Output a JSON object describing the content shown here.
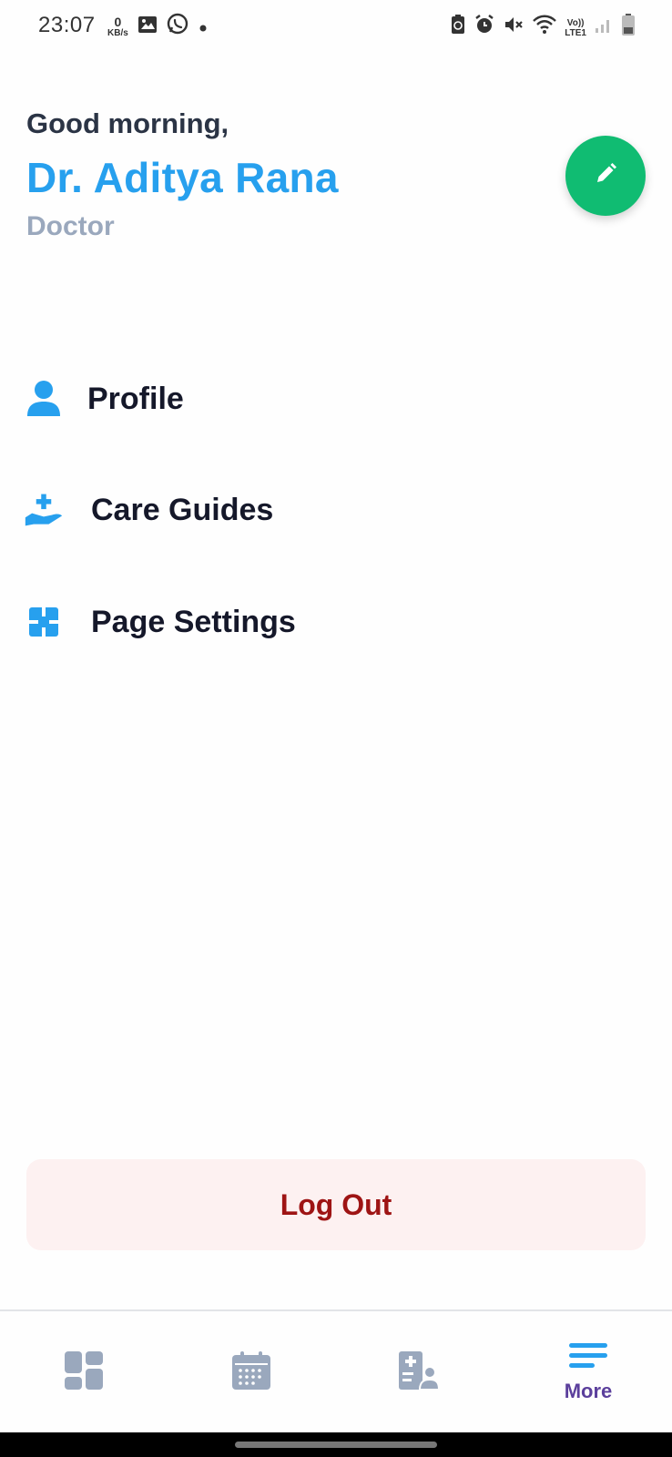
{
  "status_bar": {
    "time": "23:07",
    "net_speed_value": "0",
    "net_speed_unit": "KB/s",
    "network_label_top": "Vo))",
    "network_label_bottom": "LTE1",
    "left_icons": [
      "gallery-icon",
      "whatsapp-icon",
      "dot-icon"
    ],
    "right_icons": [
      "battery-saver-icon",
      "alarm-icon",
      "mute-icon",
      "wifi-icon",
      "signal-icon",
      "battery-icon"
    ]
  },
  "header": {
    "greeting": "Good morning,",
    "name": "Dr. Aditya Rana",
    "role": "Doctor",
    "edit_icon": "pencil-icon"
  },
  "menu": {
    "items": [
      {
        "label": "Profile",
        "icon": "user-icon"
      },
      {
        "label": "Care Guides",
        "icon": "hand-holding-medical-icon"
      },
      {
        "label": "Page Settings",
        "icon": "puzzle-icon"
      }
    ]
  },
  "logout": {
    "label": "Log Out"
  },
  "bottom_nav": {
    "items": [
      {
        "icon": "dashboard-icon",
        "label": ""
      },
      {
        "icon": "calendar-icon",
        "label": ""
      },
      {
        "icon": "patients-icon",
        "label": ""
      },
      {
        "icon": "menu-icon",
        "label": "More",
        "active": true
      }
    ]
  },
  "colors": {
    "accent": "#27a0ee",
    "fab": "#10bc72",
    "logout_text": "#9e1414",
    "logout_bg": "#fdf1f1",
    "nav_inactive": "#9aa8bd",
    "nav_active_label": "#5b3f9c"
  }
}
